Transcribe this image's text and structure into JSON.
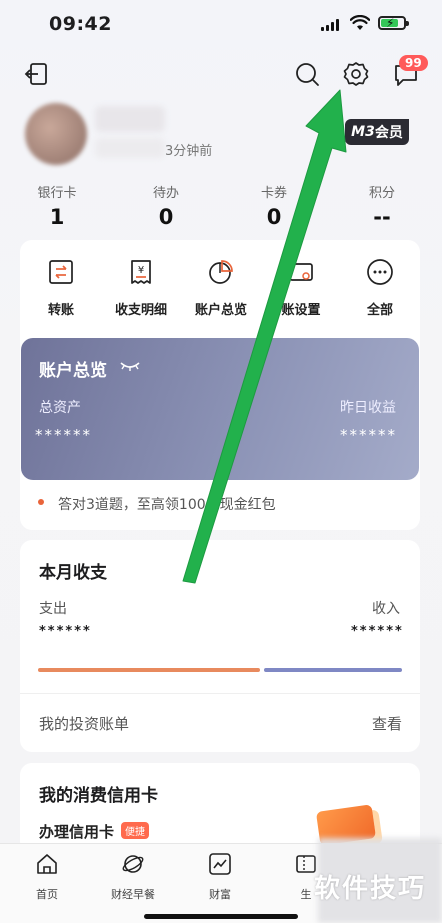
{
  "status_bar": {
    "time": "09:42"
  },
  "header": {
    "message_badge": "99"
  },
  "profile": {
    "last_login": "3分钟前",
    "member_badge_code": "M3",
    "member_badge_text": "会员"
  },
  "stats": [
    {
      "label": "银行卡",
      "value": "1"
    },
    {
      "label": "待办",
      "value": "0"
    },
    {
      "label": "卡券",
      "value": "0"
    },
    {
      "label": "积分",
      "value": "--"
    }
  ],
  "quick_menu": [
    {
      "label": "转账",
      "icon": "transfer-icon"
    },
    {
      "label": "收支明细",
      "icon": "receipt-icon"
    },
    {
      "label": "账户总览",
      "icon": "pie-chart-icon"
    },
    {
      "label": "账设置",
      "icon": "card-settings-icon"
    },
    {
      "label": "全部",
      "icon": "more-icon"
    }
  ],
  "overview": {
    "title": "账户总览",
    "total_assets_label": "总资产",
    "total_assets_value": "******",
    "yesterday_earnings_label": "昨日收益",
    "yesterday_earnings_value": "******"
  },
  "promo": {
    "text": "答对3道题，至高领100元现金红包"
  },
  "monthly": {
    "title": "本月收支",
    "expense_label": "支出",
    "expense_value": "******",
    "income_label": "收入",
    "income_value": "******",
    "investment_label": "我的投资账单",
    "view_label": "查看"
  },
  "credit_card": {
    "title": "我的消费信用卡",
    "apply_label": "办理信用卡",
    "tag": "便捷"
  },
  "tabs": [
    {
      "label": "首页",
      "icon": "home-icon"
    },
    {
      "label": "财经早餐",
      "icon": "planet-icon"
    },
    {
      "label": "财富",
      "icon": "trend-icon"
    },
    {
      "label": "生",
      "icon": "ticket-icon"
    }
  ],
  "watermark": "软件技巧",
  "colors": {
    "arrow": "#22b14c",
    "overview_start": "#6f7399",
    "overview_end": "#a4abc9",
    "badge": "#ff5a5a"
  }
}
